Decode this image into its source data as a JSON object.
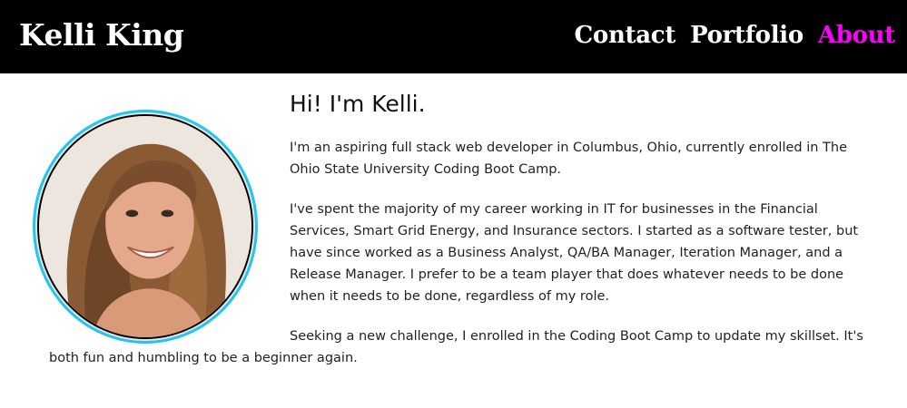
{
  "header": {
    "brand": "Kelli King",
    "nav": [
      "Contact",
      "Portfolio",
      "About"
    ],
    "active_nav": "About",
    "accent_color": "#ff00ff"
  },
  "profile": {
    "photo_icon": "profile-photo",
    "ring_color": "#1ec7f2"
  },
  "main": {
    "heading": "Hi! I'm Kelli.",
    "paragraphs": [
      "I'm an aspiring full stack web developer in Columbus, Ohio, currently enrolled in The Ohio State University Coding Boot Camp.",
      "I've spent the majority of my career working in IT for businesses in the Financial Services, Smart Grid Energy, and Insurance sectors. I started as a software tester, but have since worked as a Business Analyst, QA/BA Manager, Iteration Manager, and a Release Manager. I prefer to be a team player that does whatever needs to be done when it needs to be done, regardless of my role.",
      "Seeking a new challenge, I enrolled in the Coding Boot Camp to update my skillset. It's both fun and humbling to be a beginner again."
    ]
  }
}
